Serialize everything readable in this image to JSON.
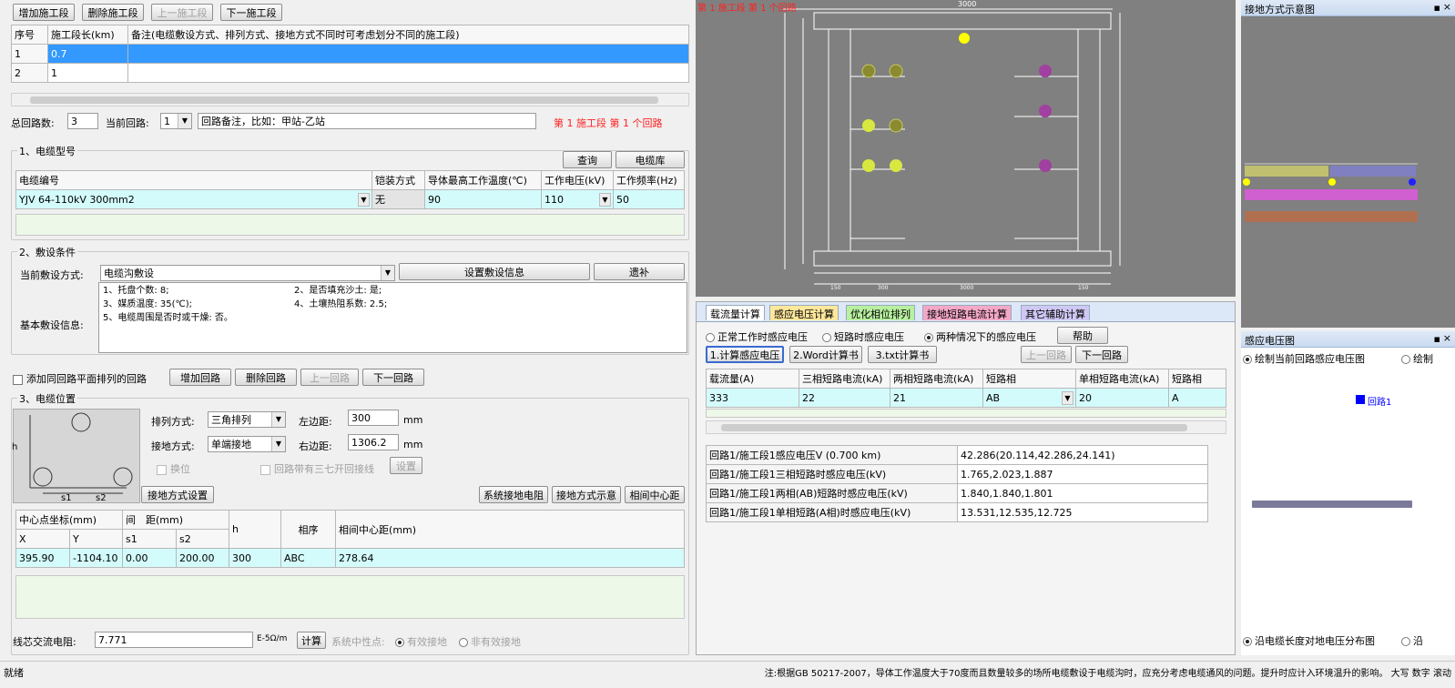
{
  "top_buttons": {
    "add": "增加施工段",
    "delete": "删除施工段",
    "prev": "上一施工段",
    "next": "下一施工段"
  },
  "section_table": {
    "headers": [
      "序号",
      "施工段长(km)",
      "备注(电缆敷设方式、排列方式、接地方式不同时可考虑划分不同的施工段)"
    ],
    "rows": [
      [
        "1",
        "0.7",
        ""
      ],
      [
        "2",
        "1",
        ""
      ]
    ]
  },
  "circuit_row": {
    "total_label": "总回路数:",
    "total_value": "3",
    "current_label": "当前回路:",
    "current_value": "1",
    "note_value": "回路备注，比如：甲站-乙站",
    "status": "第 1 施工段 第 1 个回路"
  },
  "cable_model": {
    "title": "1、电缆型号",
    "query_btn": "查询",
    "library_btn": "电缆库",
    "headers": [
      "电缆编号",
      "铠装方式",
      "导体最高工作温度(℃)",
      "工作电压(kV)",
      "工作频率(Hz)"
    ],
    "row": [
      "YJV 64-110kV 300mm2",
      "无",
      "90",
      "110",
      "50"
    ]
  },
  "laying": {
    "title": "2、敷设条件",
    "method_label": "当前敷设方式:",
    "method_value": "电缆沟敷设",
    "set_btn": "设置敷设信息",
    "advanced_btn": "遗补",
    "basic_label": "基本敷设信息:",
    "info_lines": [
      "1、托盘个数: 8;",
      "2、是否填充沙土: 是;",
      "3、媒质温度: 35(℃);",
      "4、土壤热阻系数: 2.5;",
      "5、电缆周围是否时或干燥: 否。"
    ]
  },
  "add_line": {
    "label": "添加同回路平面排列的回路",
    "add": "增加回路",
    "delete": "删除回路",
    "prev": "上一回路",
    "next": "下一回路"
  },
  "position": {
    "title": "3、电缆位置",
    "arrange_label": "排列方式:",
    "arrange_value": "三角排列",
    "ground_label": "接地方式:",
    "ground_value": "单端接地",
    "left_label": "左边距:",
    "left_value": "300",
    "right_label": "右边距:",
    "right_value": "1306.2",
    "unit": "mm",
    "transpose_label": "换位",
    "threephase_label": "回路带有三七开回接线",
    "settings_btn": "设置",
    "ground_settings_btn": "接地方式设置",
    "btn1": "系统接地电阻",
    "btn2": "接地方式示意",
    "btn3": "相间中心距",
    "diagram_labels": [
      "h",
      "s1",
      "s2"
    ],
    "table_headers": {
      "center": "中心点坐标(mm)",
      "spacing": "间　距(mm)",
      "h": "h",
      "phase": "相序",
      "phase_dist": "相间中心距(mm)",
      "x": "X",
      "y": "Y",
      "s1": "s1",
      "s2": "s2"
    },
    "row": [
      "395.90",
      "-1104.10",
      "0.00",
      "200.00",
      "300",
      "ABC",
      "278.64"
    ]
  },
  "bottom_row": {
    "label": "线芯交流电阻:",
    "value": "7.771",
    "unit": "E-5Ω/m",
    "calc_btn": "计算",
    "neutral_label": "系统中性点:",
    "opt1": "有效接地",
    "opt2": "非有效接地"
  },
  "drawing": {
    "status": "第 1 施工段 第 1 个回路",
    "top_dim": "3000"
  },
  "calc_tabs": [
    "载流量计算",
    "感应电压计算",
    "优化相位排列",
    "接地短路电流计算",
    "其它辅助计算"
  ],
  "calc_panel": {
    "radio1": "正常工作时感应电压",
    "radio2": "短路时感应电压",
    "radio3": "两种情况下的感应电压",
    "help_btn": "帮助",
    "btn1": "1.计算感应电压",
    "btn2": "2.Word计算书",
    "btn3": "3.txt计算书",
    "prev_btn": "上一回路",
    "next_btn": "下一回路",
    "headers": [
      "载流量(A)",
      "三相短路电流(kA)",
      "两相短路电流(kA)",
      "短路相",
      "单相短路电流(kA)",
      "短路相"
    ],
    "row": [
      "333",
      "22",
      "21",
      "AB",
      "20",
      "A"
    ],
    "results": [
      [
        "回路1/施工段1感应电压V (0.700 km)",
        "42.286(20.114,42.286,24.141)"
      ],
      [
        "回路1/施工段1三相短路时感应电压(kV)",
        "1.765,2.023,1.887"
      ],
      [
        "回路1/施工段1两相(AB)短路时感应电压(kV)",
        "1.840,1.840,1.801"
      ],
      [
        "回路1/施工段1单相短路(A相)时感应电压(kV)",
        "13.531,12.535,12.725"
      ]
    ]
  },
  "right_panels": {
    "grounding_title": "接地方式示意图",
    "voltage_title": "感应电压图",
    "radio_draw_current": "绘制当前回路感应电压图",
    "radio_draw_other": "绘制",
    "legend_item": "回路1",
    "bottom_radio": "沿电缆长度对地电压分布图",
    "bottom_radio2": "沿"
  },
  "status_bar": {
    "left": "就绪",
    "right": "注:根据GB 50217-2007，导体工作温度大于70度而且数量较多的场所电缆敷设于电缆沟时，应充分考虑电缆通风的问题。提升时应计入环境温升的影响。  大写  数字  滚动"
  }
}
